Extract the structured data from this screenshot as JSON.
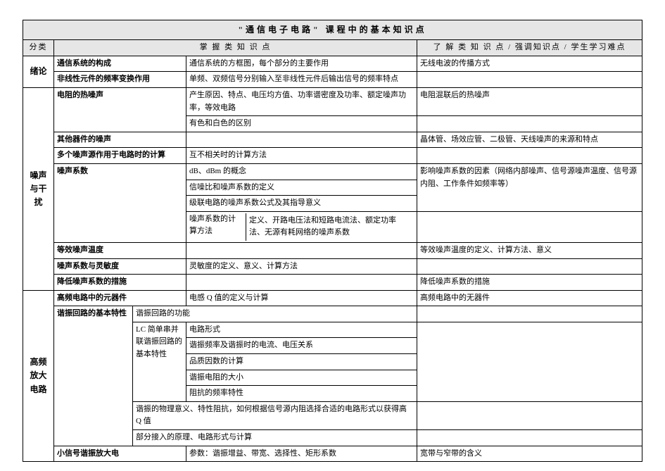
{
  "title": "\"通信电子电路\" 课程中的基本知识点",
  "header": {
    "cat": "分类",
    "master": "掌 握 类 知 识 点",
    "understand": "了 解 类 知 识 点 /  强调知识点 /  学生学习难点"
  },
  "cats": {
    "intro": "绪论",
    "noise": "噪声与干扰",
    "hf": "高频放大电路"
  },
  "rows": {
    "r1_sub": "通信系统的构成",
    "r1_mas": "通信系统的方框图，每个部分的主要作用",
    "r1_und": "无线电波的传播方式",
    "r2_sub": "非线性元件的频率变换作用",
    "r2_mas": "单频、双频信号分别输入至非线性元件后输出信号的频率特点",
    "r2_und": "",
    "r3_sub": "电阻的热噪声",
    "r3_mas": "产生原因、特点、电压均方值、功率谱密度及功率、额定噪声功率，等效电路",
    "r3_und": "电阻混联后的热噪声",
    "r4_mas": "有色和白色的区别",
    "r4_und": "",
    "r5_sub": "其他器件的噪声",
    "r5_mas": "",
    "r5_und": "晶体管、场效应管、二极管、天线噪声的来源和特点",
    "r6_sub": "多个噪声源作用于电路时的计算",
    "r6_mas": "互不相关时的计算方法",
    "r6_und": "",
    "r7_sub": "噪声系数",
    "r7_mas": "dB、dBm 的概念",
    "r7_und": "影响噪声系数的因素（网络内部噪声、信号源噪声温度、信号源内阻、工作条件如频率等）",
    "r8_mas": "信噪比和噪声系数的定义",
    "r9_mas": "级联电路的噪声系数公式及其指导意义",
    "r10_sub2": "噪声系数的计算方法",
    "r10_mas": "定义、开路电压法和短路电流法、额定功率法、无源有耗网络的噪声系数",
    "r10_und": "",
    "r11_sub": "等效噪声温度",
    "r11_mas": "",
    "r11_und": "等效噪声温度的定义、计算方法、意义",
    "r12_sub": "噪声系数与灵敏度",
    "r12_mas": "灵敏度的定义、意义、计算方法",
    "r12_und": "",
    "r13_sub": "降低噪声系数的措施",
    "r13_mas": "",
    "r13_und": "降低噪声系数的措施",
    "r14_sub": "高频电路中的元器件",
    "r14_mas": "电感 Q 值的定义与计算",
    "r14_und": "高频电路中的无器件",
    "r15_sub": "谐振回路的基本特性",
    "r15_mas": "谐振回路的功能",
    "r15_und": "",
    "r16_sub2": "LC 简单串并联谐振回路的基本特性",
    "r16_mas": "电路形式",
    "r17_mas": "谐振频率及谐振时的电流、电压关系",
    "r18_mas": "品质因数的计算",
    "r19_mas": "谐振电阻的大小",
    "r20_mas": "阻抗的频率特性",
    "r21_mas": "谐振的物理意义、特性阻抗，如何根据信号源内阻选择合适的电路形式以获得高 Q 值",
    "r22_mas": "部分接入的原理、电路形式与计算",
    "r23_sub": "小信号谐振放大电",
    "r23_mas": "参数：谐振增益、带宽、选择性、矩形系数",
    "r23_und": "宽带与窄带的含义"
  }
}
